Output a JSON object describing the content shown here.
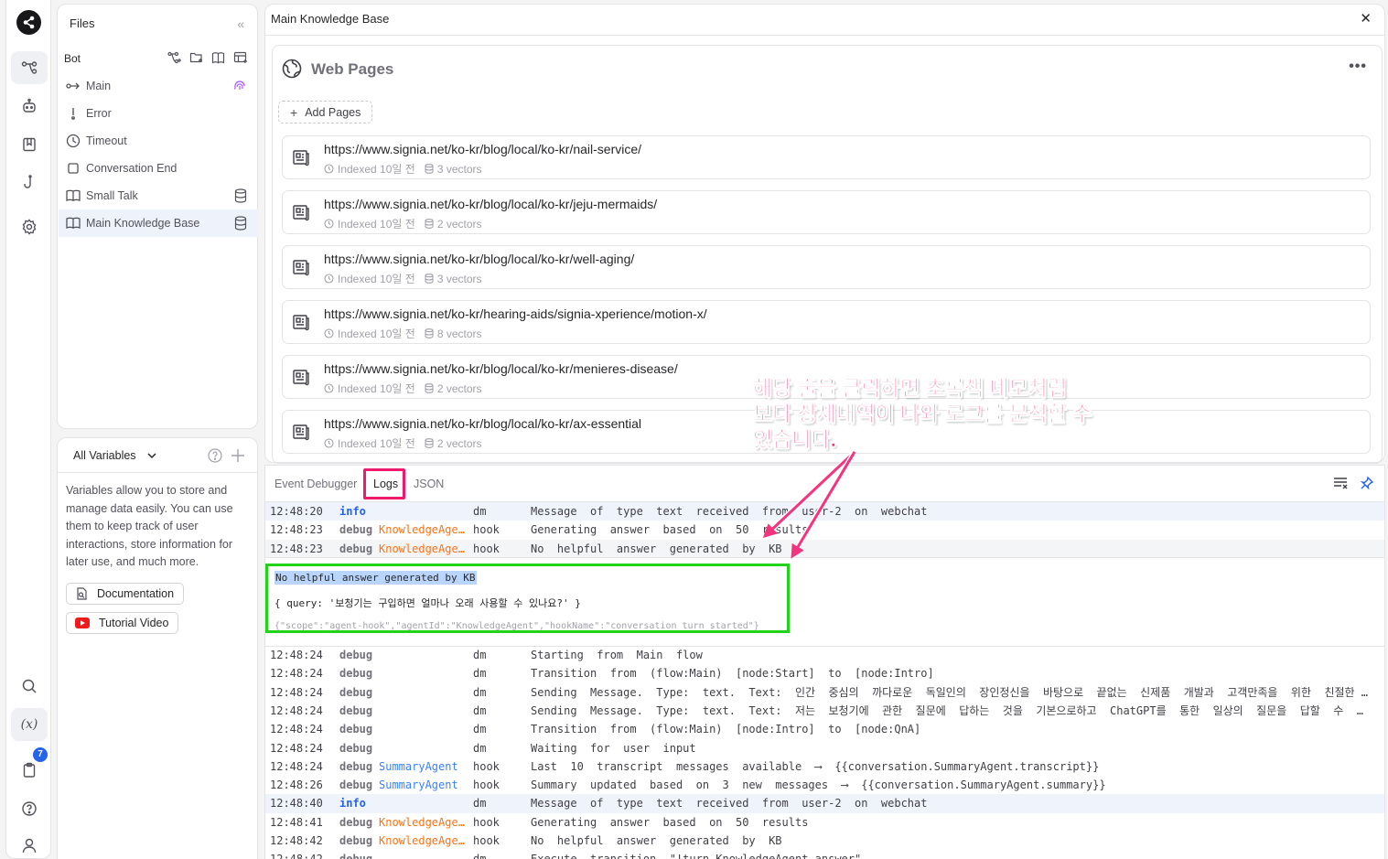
{
  "rail": {
    "badge": "7"
  },
  "files": {
    "title": "Files",
    "bot_label": "Bot",
    "items": [
      {
        "label": "Main"
      },
      {
        "label": "Error"
      },
      {
        "label": "Timeout"
      },
      {
        "label": "Conversation End"
      },
      {
        "label": "Small Talk"
      },
      {
        "label": "Main Knowledge Base"
      }
    ]
  },
  "variables": {
    "title": "All Variables",
    "description": "Variables allow you to store and manage data easily. You can use them to keep track of user interactions, store information for later use, and much more.",
    "documentation_label": "Documentation",
    "tutorial_label": "Tutorial Video"
  },
  "main": {
    "title": "Main Knowledge Base",
    "section_title": "Web Pages",
    "add_pages_label": "Add Pages",
    "pages": [
      {
        "url": "https://www.signia.net/ko-kr/blog/local/ko-kr/nail-service/",
        "indexed": "Indexed 10일 전",
        "vectors": "3 vectors"
      },
      {
        "url": "https://www.signia.net/ko-kr/blog/local/ko-kr/jeju-mermaids/",
        "indexed": "Indexed 10일 전",
        "vectors": "2 vectors"
      },
      {
        "url": "https://www.signia.net/ko-kr/blog/local/ko-kr/well-aging/",
        "indexed": "Indexed 10일 전",
        "vectors": "3 vectors"
      },
      {
        "url": "https://www.signia.net/ko-kr/hearing-aids/signia-xperience/motion-x/",
        "indexed": "Indexed 10일 전",
        "vectors": "8 vectors"
      },
      {
        "url": "https://www.signia.net/ko-kr/blog/local/ko-kr/menieres-disease/",
        "indexed": "Indexed 10일 전",
        "vectors": "2 vectors"
      },
      {
        "url": "https://www.signia.net/ko-kr/blog/local/ko-kr/ax-essential",
        "indexed": "Indexed 10일 전",
        "vectors": "2 vectors"
      }
    ]
  },
  "logs": {
    "tabs": [
      {
        "label": "Event Debugger"
      },
      {
        "label": "Logs"
      },
      {
        "label": "JSON"
      }
    ],
    "lines_top": [
      {
        "time": "12:48:20",
        "level": "info",
        "source": "",
        "cat": "dm",
        "msg": "Message  of  type  text  received  from  user-2  on  webchat"
      },
      {
        "time": "12:48:23",
        "level": "debug",
        "source": "KnowledgeAgent",
        "cat": "hook",
        "msg": "Generating  answer  based  on  50  results"
      },
      {
        "time": "12:48:23",
        "level": "debug",
        "source": "KnowledgeAgent",
        "cat": "hook",
        "msg": "No  helpful  answer  generated  by  KB"
      }
    ],
    "detail": {
      "title": "No helpful answer generated by KB",
      "query": "{ query: '보청기는 구입하면 얼마나 오래 사용할 수 있나요?' }",
      "meta": "{\"scope\":\"agent-hook\",\"agentId\":\"KnowledgeAgent\",\"hookName\":\"conversation_turn_started\"}"
    },
    "lines_bottom": [
      {
        "time": "12:48:24",
        "level": "debug",
        "source": "",
        "cat": "dm",
        "msg": "Starting  from  Main  flow"
      },
      {
        "time": "12:48:24",
        "level": "debug",
        "source": "",
        "cat": "dm",
        "msg": "Transition  from  (flow:Main)  [node:Start]  to  [node:Intro]"
      },
      {
        "time": "12:48:24",
        "level": "debug",
        "source": "",
        "cat": "dm",
        "msg": "Sending  Message.  Type:  text.  Text:  인간  중심의  까다로운  독일인의  장인정신을  바탕으로  끝없는  신제품  개발과  고객만족을  위한  친절한  서비스"
      },
      {
        "time": "12:48:24",
        "level": "debug",
        "source": "",
        "cat": "dm",
        "msg": "Sending  Message.  Type:  text.  Text:  저는  보청기에  관한  질문에  답하는  것을  기본으로하고  ChatGPT를  통한  일상의  질문을  답할  수  있도록  합니다"
      },
      {
        "time": "12:48:24",
        "level": "debug",
        "source": "",
        "cat": "dm",
        "msg": "Transition  from  (flow:Main)  [node:Intro]  to  [node:QnA]"
      },
      {
        "time": "12:48:24",
        "level": "debug",
        "source": "",
        "cat": "dm",
        "msg": "Waiting  for  user  input"
      },
      {
        "time": "12:48:24",
        "level": "debug",
        "source": "SummaryAgent",
        "cat": "hook",
        "msg": "Last  10  transcript  messages  available  ⟶  {{conversation.SummaryAgent.transcript}}"
      },
      {
        "time": "12:48:26",
        "level": "debug",
        "source": "SummaryAgent",
        "cat": "hook",
        "msg": "Summary  updated  based  on  3  new  messages  ⟶  {{conversation.SummaryAgent.summary}}"
      },
      {
        "time": "12:48:40",
        "level": "info",
        "source": "",
        "cat": "dm",
        "msg": "Message  of  type  text  received  from  user-2  on  webchat"
      },
      {
        "time": "12:48:41",
        "level": "debug",
        "source": "KnowledgeAgent",
        "cat": "hook",
        "msg": "Generating  answer  based  on  50  results"
      },
      {
        "time": "12:48:42",
        "level": "debug",
        "source": "KnowledgeAgent",
        "cat": "hook",
        "msg": "No  helpful  answer  generated  by  KB"
      },
      {
        "time": "12:48:42",
        "level": "debug",
        "source": "",
        "cat": "dm",
        "msg": "Execute  transition  \"!turn.KnowledgeAgent.answer\""
      }
    ]
  },
  "annotation": {
    "line1": "해당 줄을 클릭하면 초록색 네모처럼",
    "line2": "보다 상세내역이 나와 로그를 분석할 수",
    "line3": "있습니다."
  },
  "colors": {
    "accent": "#2563eb",
    "annotation": "#f5337e",
    "highlight_box": "#22d31a",
    "tab_highlight": "#ef1a6b"
  }
}
